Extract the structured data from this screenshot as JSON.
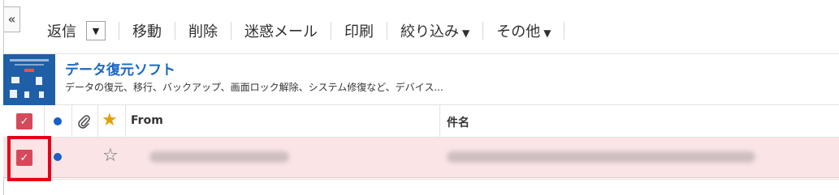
{
  "sidebar": {
    "collapse_glyph": "«"
  },
  "toolbar": {
    "reply": "返信",
    "reply_dropdown_glyph": "▼",
    "move": "移動",
    "delete": "削除",
    "spam": "迷惑メール",
    "print": "印刷",
    "filter": "絞り込み",
    "other": "その他",
    "caret": "▼"
  },
  "ad": {
    "title": "データ復元ソフト",
    "description": "データの復元、移行、バックアップ、画面ロック解除、システム修復など、デバイス..."
  },
  "table": {
    "headers": {
      "from": "From",
      "subject": "件名"
    },
    "select_all_checked": true,
    "star_header_glyph": "★"
  },
  "rows": [
    {
      "checked": true,
      "unread": true,
      "star_glyph": "☆",
      "from_redacted": true,
      "subject_redacted": true
    }
  ],
  "colors": {
    "accent_red": "#d6495a",
    "link_blue": "#1a67c4",
    "unread_dot": "#1a5fc8",
    "selected_row_bg": "#fbe4e6",
    "highlight_box": "#e8001a",
    "star_gold": "#e0a100"
  }
}
